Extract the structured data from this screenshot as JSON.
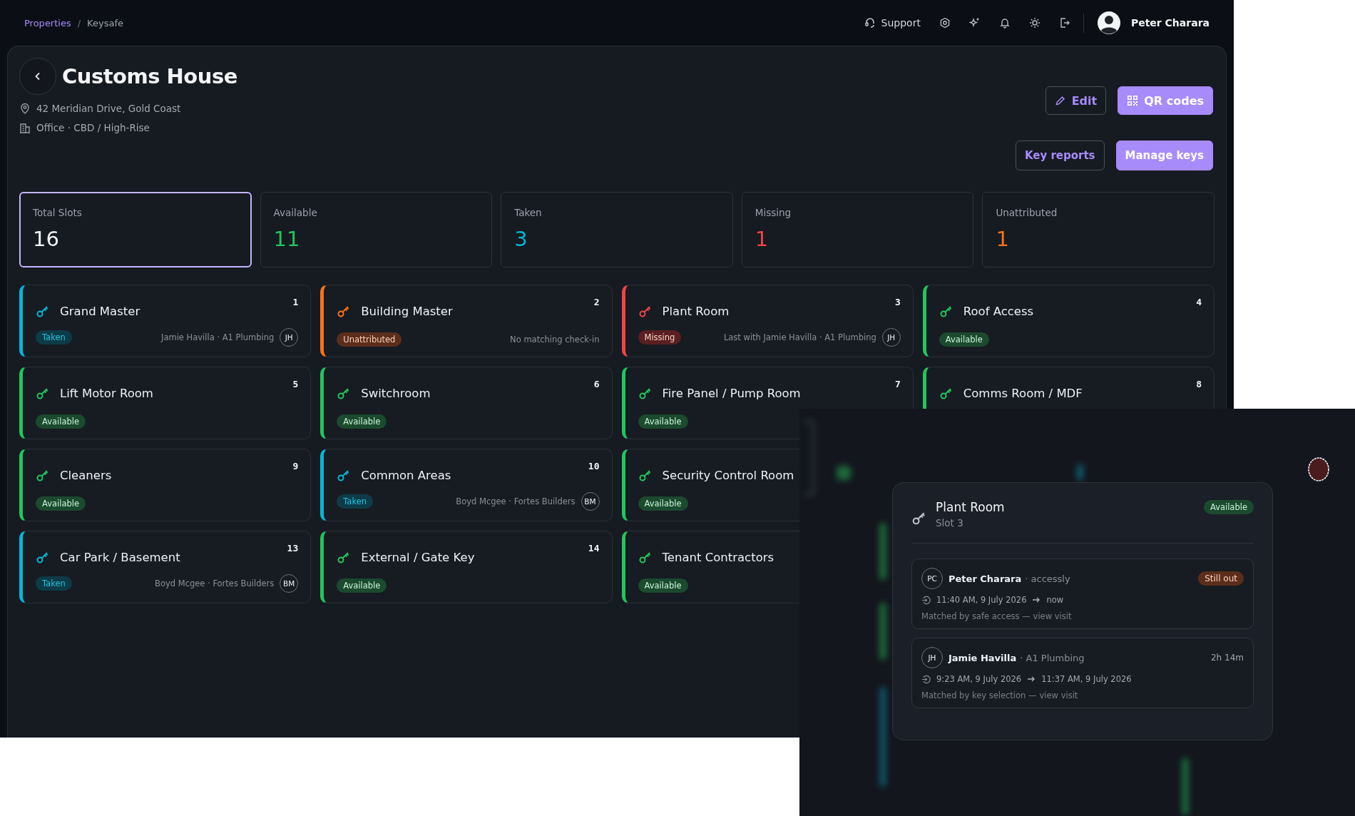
{
  "breadcrumb": [
    {
      "label": "Properties",
      "link": true
    },
    {
      "label": "Keysafe",
      "link": false
    }
  ],
  "breadcrumb_separator": "/",
  "topbar": {
    "support": "Support",
    "user": "Peter Charara"
  },
  "property": {
    "title": "Customs House",
    "address": "42 Meridian Drive, Gold Coast",
    "type": "Office · CBD / High-Rise"
  },
  "action_rows": [
    [
      {
        "label": "Edit",
        "kind": "outline"
      },
      {
        "label": "QR codes",
        "kind": "primary"
      }
    ],
    [
      {
        "label": "Key reports",
        "kind": "outline"
      },
      {
        "label": "Manage keys",
        "kind": "primary"
      }
    ]
  ],
  "stats": [
    {
      "label": "Total Slots",
      "value": "16",
      "kind": "total",
      "selected": true
    },
    {
      "label": "Available",
      "value": "11",
      "kind": "available",
      "selected": false
    },
    {
      "label": "Taken",
      "value": "3",
      "kind": "taken",
      "selected": false
    },
    {
      "label": "Missing",
      "value": "1",
      "kind": "missing",
      "selected": false
    },
    {
      "label": "Unattributed",
      "value": "1",
      "kind": "unattributed",
      "selected": false
    }
  ],
  "key_rows": [
    [
      {
        "number": "1",
        "name": "Grand Master",
        "kind": "taken",
        "badge": "Taken",
        "holder": "Jamie Havilla · A1 Plumbing",
        "initials": "JH"
      },
      {
        "number": "2",
        "name": "Building Master",
        "kind": "unattributed",
        "badge": "Unattributed",
        "holder": "No matching check-in"
      },
      {
        "number": "3",
        "name": "Plant Room",
        "kind": "missing",
        "badge": "Missing",
        "holder": "Last with Jamie Havilla · A1 Plumbing",
        "initials": "JH"
      },
      {
        "number": "4",
        "name": "Roof Access",
        "kind": "available",
        "badge": "Available"
      }
    ],
    [
      {
        "number": "5",
        "name": "Lift Motor Room",
        "kind": "available",
        "badge": "Available"
      },
      {
        "number": "6",
        "name": "Switchroom",
        "kind": "available",
        "badge": "Available"
      },
      {
        "number": "7",
        "name": "Fire Panel / Pump Room",
        "kind": "available",
        "badge": "Available"
      },
      {
        "number": "8",
        "name": "Comms Room / MDF",
        "kind": "available"
      }
    ],
    [
      {
        "number": "9",
        "name": "Cleaners",
        "kind": "available",
        "badge": "Available"
      },
      {
        "number": "10",
        "name": "Common Areas",
        "kind": "taken",
        "badge": "Taken",
        "holder": "Boyd Mcgee · Fortes Builders",
        "initials": "BM"
      },
      {
        "name": "Security Control Room",
        "kind": "available",
        "badge": "Available"
      }
    ],
    [
      {
        "number": "13",
        "name": "Car Park / Basement",
        "kind": "taken",
        "badge": "Taken",
        "holder": "Boyd Mcgee · Fortes Builders",
        "initials": "BM"
      },
      {
        "number": "14",
        "name": "External / Gate Key",
        "kind": "available",
        "badge": "Available"
      },
      {
        "name": "Tenant Contractors",
        "kind": "available",
        "badge": "Available"
      }
    ]
  ],
  "popover": {
    "title": "Plant Room",
    "subtitle": "Slot 3",
    "badge": "Available",
    "visits": [
      {
        "initials": "PC",
        "name": "Peter Charara",
        "org": "· accessly",
        "tag": {
          "kind": "badge",
          "text": "Still out"
        },
        "from": "11:40 AM, 9 July 2026",
        "to": "now",
        "match": "Matched by safe access —",
        "link": "view visit"
      },
      {
        "initials": "JH",
        "name": "Jamie Havilla",
        "org": "· A1 Plumbing",
        "tag": {
          "kind": "plain",
          "text": "2h 14m"
        },
        "from": "9:23 AM, 9 July 2026",
        "to": "11:37 AM, 9 July 2026",
        "match": "Matched by key selection —",
        "link": "view visit"
      }
    ]
  }
}
